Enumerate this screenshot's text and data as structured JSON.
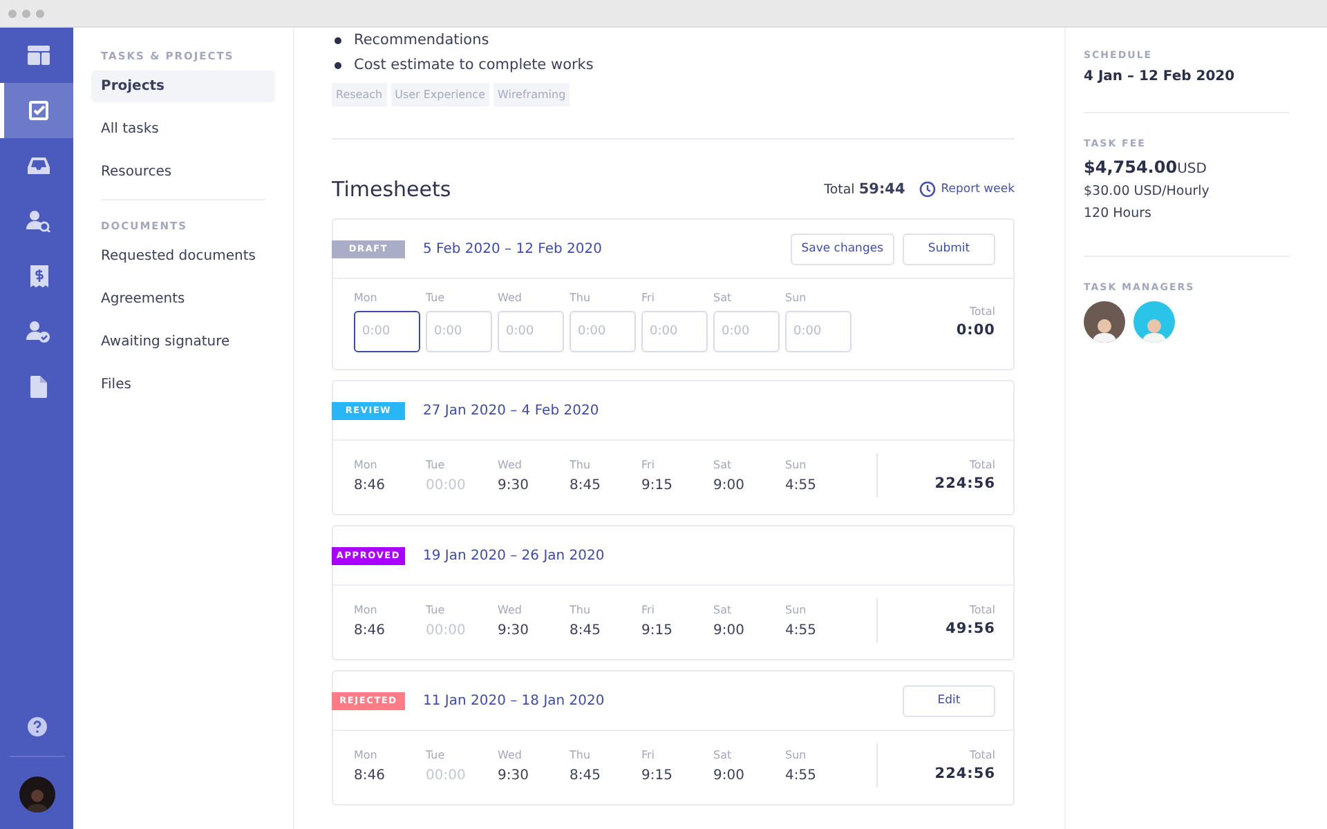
{
  "rail": {
    "items": [
      {
        "selected": false
      },
      {
        "selected": true
      },
      {
        "selected": false
      },
      {
        "selected": false
      },
      {
        "selected": false
      },
      {
        "selected": false
      },
      {
        "selected": false
      }
    ]
  },
  "nav": {
    "sections": [
      {
        "title": "TASKS & PROJECTS",
        "items": [
          {
            "label": "Projects",
            "selected": true
          },
          {
            "label": "All tasks",
            "selected": false
          },
          {
            "label": "Resources",
            "selected": false
          }
        ]
      },
      {
        "title": "DOCUMENTS",
        "items": [
          {
            "label": "Requested documents",
            "selected": false
          },
          {
            "label": "Agreements",
            "selected": false
          },
          {
            "label": "Awaiting signature",
            "selected": false
          },
          {
            "label": "Files",
            "selected": false
          }
        ]
      }
    ]
  },
  "bullets": [
    "Recommendations",
    "Cost estimate to complete works"
  ],
  "tags": [
    "Reseach",
    "User Experience",
    "Wireframing"
  ],
  "timesheets": {
    "title": "Timesheets",
    "total_label": "Total",
    "total": "59:44",
    "report_link": "Report week",
    "cards": [
      {
        "kind": "editable",
        "status": "DRAFT",
        "color": "#a9aec6",
        "range": "5 Feb 2020 – 12 Feb 2020",
        "actions": [
          "Save changes",
          "Submit"
        ],
        "total_label": "Total",
        "total": "0:00",
        "days": [
          {
            "day": "Mon",
            "placeholder": "0:00",
            "focused": true
          },
          {
            "day": "Tue",
            "placeholder": "0:00",
            "focused": false
          },
          {
            "day": "Wed",
            "placeholder": "0:00",
            "focused": false
          },
          {
            "day": "Thu",
            "placeholder": "0:00",
            "focused": false
          },
          {
            "day": "Fri",
            "placeholder": "0:00",
            "focused": false
          },
          {
            "day": "Sat",
            "placeholder": "0:00",
            "focused": false
          },
          {
            "day": "Sun",
            "placeholder": "0:00",
            "focused": false
          }
        ]
      },
      {
        "kind": "readonly",
        "status": "REVIEW",
        "color": "#29b6f6",
        "range": "27 Jan 2020 – 4 Feb 2020",
        "total_label": "Total",
        "total": "224:56",
        "days": [
          {
            "day": "Mon",
            "value": "8:46",
            "muted": false
          },
          {
            "day": "Tue",
            "value": "00:00",
            "muted": true
          },
          {
            "day": "Wed",
            "value": "9:30",
            "muted": false
          },
          {
            "day": "Thu",
            "value": "8:45",
            "muted": false
          },
          {
            "day": "Fri",
            "value": "9:15",
            "muted": false
          },
          {
            "day": "Sat",
            "value": "9:00",
            "muted": false
          },
          {
            "day": "Sun",
            "value": "4:55",
            "muted": false
          }
        ]
      },
      {
        "kind": "readonly",
        "status": "APPROVED",
        "color": "#aa00ff",
        "range": "19 Jan 2020 – 26 Jan 2020",
        "total_label": "Total",
        "total": "49:56",
        "days": [
          {
            "day": "Mon",
            "value": "8:46",
            "muted": false
          },
          {
            "day": "Tue",
            "value": "00:00",
            "muted": true
          },
          {
            "day": "Wed",
            "value": "9:30",
            "muted": false
          },
          {
            "day": "Thu",
            "value": "8:45",
            "muted": false
          },
          {
            "day": "Fri",
            "value": "9:15",
            "muted": false
          },
          {
            "day": "Sat",
            "value": "9:00",
            "muted": false
          },
          {
            "day": "Sun",
            "value": "4:55",
            "muted": false
          }
        ]
      },
      {
        "kind": "readonly",
        "status": "REJECTED",
        "color": "#ff7b86",
        "range": "11 Jan 2020 – 18 Jan 2020",
        "actions": [
          "Edit"
        ],
        "total_label": "Total",
        "total": "224:56",
        "days": [
          {
            "day": "Mon",
            "value": "8:46",
            "muted": false
          },
          {
            "day": "Tue",
            "value": "00:00",
            "muted": true
          },
          {
            "day": "Wed",
            "value": "9:30",
            "muted": false
          },
          {
            "day": "Thu",
            "value": "8:45",
            "muted": false
          },
          {
            "day": "Fri",
            "value": "9:15",
            "muted": false
          },
          {
            "day": "Sat",
            "value": "9:00",
            "muted": false
          },
          {
            "day": "Sun",
            "value": "4:55",
            "muted": false
          }
        ]
      }
    ]
  },
  "details": {
    "schedule_label": "SCHEDULE",
    "schedule": "4 Jan – 12 Feb 2020",
    "fee_label": "TASK FEE",
    "fee": "$4,754.00",
    "fee_currency": "USD",
    "rate": "$30.00 USD/Hourly",
    "hours": "120 Hours",
    "managers_label": "TASK MANAGERS",
    "managers": [
      {
        "color": "#6b5a52"
      },
      {
        "color": "#29c4e8"
      }
    ]
  }
}
